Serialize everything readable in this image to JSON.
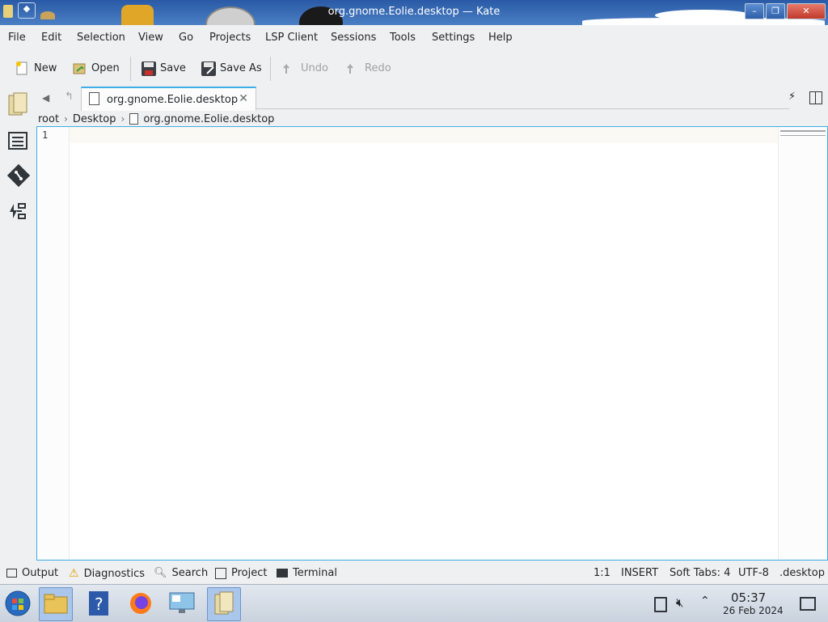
{
  "window": {
    "title": "org.gnome.Eolie.desktop — Kate"
  },
  "menubar": {
    "items": [
      "File",
      "Edit",
      "Selection",
      "View",
      "Go",
      "Projects",
      "LSP Client",
      "Sessions",
      "Tools",
      "Settings",
      "Help"
    ]
  },
  "toolbar": {
    "new": "New",
    "open": "Open",
    "save": "Save",
    "save_as": "Save As",
    "undo": "Undo",
    "redo": "Redo"
  },
  "tabs": {
    "active": {
      "label": "org.gnome.Eolie.desktop",
      "close_icon": "close-icon"
    }
  },
  "breadcrumb": [
    "root",
    "Desktop",
    "org.gnome.Eolie.desktop"
  ],
  "editor": {
    "line_numbers": [
      "1"
    ]
  },
  "toolviews": {
    "output": "Output",
    "diagnostics": "Diagnostics",
    "search": "Search",
    "project": "Project",
    "terminal": "Terminal"
  },
  "status": {
    "cursor": "1:1",
    "mode": "INSERT",
    "indent": "Soft Tabs: 4",
    "encoding": "UTF-8",
    "filetype": ".desktop"
  },
  "taskbar": {
    "time": "05:37",
    "date": "26 Feb 2024"
  },
  "colors": {
    "accent": "#3daee9",
    "titlebar": "#3d6fb3"
  }
}
